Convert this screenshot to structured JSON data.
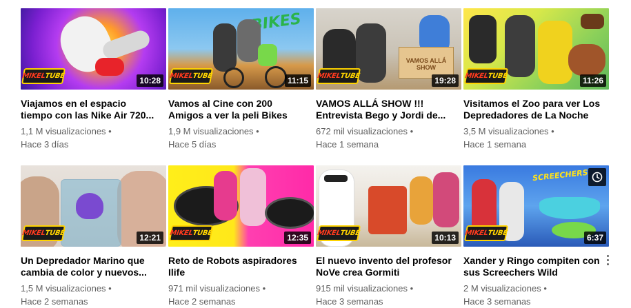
{
  "colors": {
    "duration_bg": "#000000",
    "title": "#030303",
    "meta": "#606060"
  },
  "logo": {
    "part1": "MIKEL",
    "part2": "TUBE"
  },
  "thumb_graphics": {
    "bikes": "BIKES",
    "sign": "VAMOS ALLÁ SHOW",
    "screechers": "SCREECHERS"
  },
  "videos": [
    {
      "title": "Viajamos en el espacio tiempo con las Nike Air 720...",
      "views": "1,1 M visualizaciones •",
      "age": "Hace 3 días",
      "duration": "10:28"
    },
    {
      "title": "Vamos al Cine con 200 Amigos a ver la peli Bikes",
      "views": "1,9 M visualizaciones •",
      "age": "Hace 5 días",
      "duration": "11:15"
    },
    {
      "title": "VAMOS ALLÁ SHOW !!! Entrevista Bego y Jordi de...",
      "views": "672 mil visualizaciones •",
      "age": "Hace 1 semana",
      "duration": "19:28"
    },
    {
      "title": "Visitamos el Zoo para ver Los Depredadores de La Noche",
      "views": "3,5 M visualizaciones •",
      "age": "Hace 1 semana",
      "duration": "11:26"
    },
    {
      "title": "Un Depredador Marino que cambia de color y nuevos...",
      "views": "1,5 M visualizaciones •",
      "age": "Hace 2 semanas",
      "duration": "12:21"
    },
    {
      "title": "Reto de Robots aspiradores Ilife",
      "views": "971 mil visualizaciones •",
      "age": "Hace 2 semanas",
      "duration": "12:35"
    },
    {
      "title": "El nuevo invento del profesor NoVe crea Gormiti",
      "views": "915 mil visualizaciones •",
      "age": "Hace 3 semanas",
      "duration": "10:13"
    },
    {
      "title": "Xander y Ringo compiten con sus Screechers Wild",
      "views": "2 M visualizaciones •",
      "age": "Hace 3 semanas",
      "duration": "6:37"
    }
  ]
}
